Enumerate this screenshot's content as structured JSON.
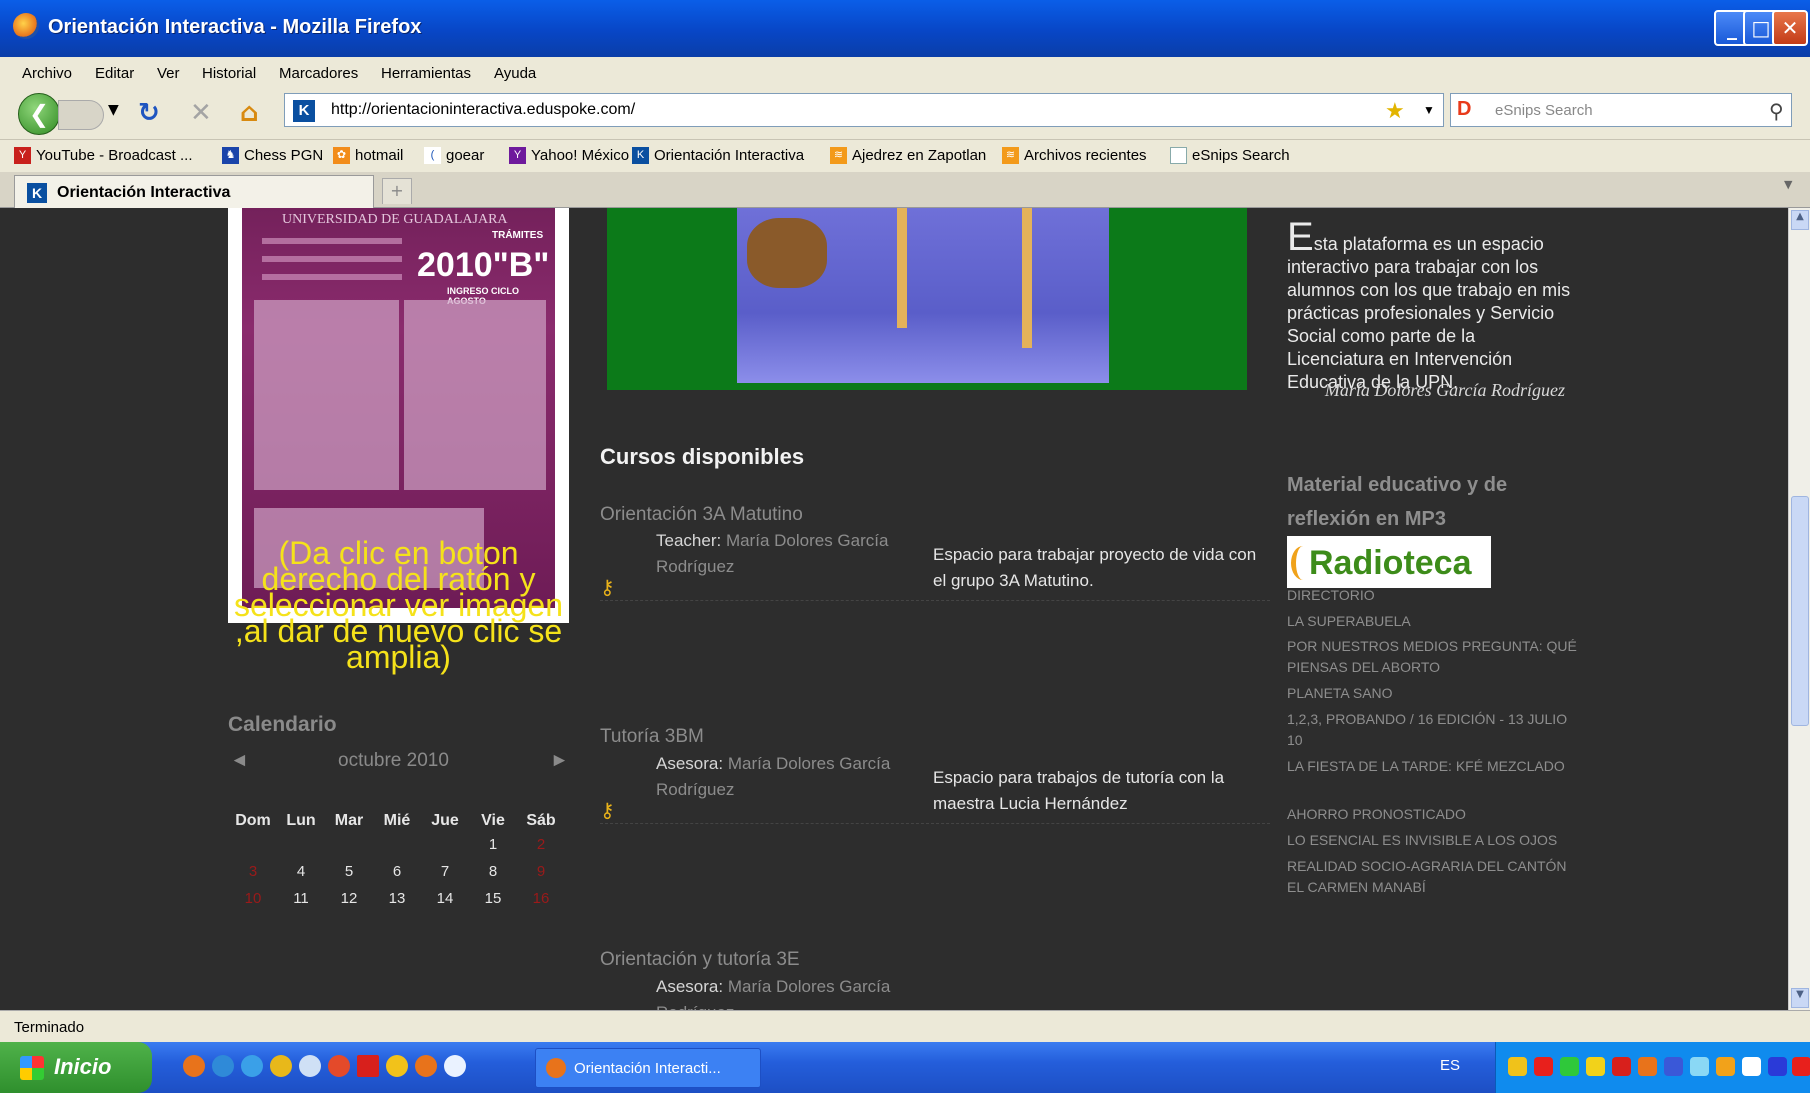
{
  "window": {
    "title": "Orientación Interactiva - Mozilla Firefox"
  },
  "menu": [
    "Archivo",
    "Editar",
    "Ver",
    "Historial",
    "Marcadores",
    "Herramientas",
    "Ayuda"
  ],
  "nav": {
    "url": "http://orientacioninteractiva.eduspoke.com/",
    "search_placeholder": "eSnips Search"
  },
  "bookmarks": [
    "YouTube - Broadcast ...",
    "Chess PGN",
    "hotmail",
    "goear",
    "Yahoo! México",
    "Orientación Interactiva",
    "Ajedrez en Zapotlan",
    "Archivos recientes",
    "eSnips Search"
  ],
  "tab": {
    "label": "Orientación Interactiva"
  },
  "poster": {
    "university": "UNIVERSIDAD DE GUADALAJARA",
    "big": "2010\"B\"",
    "sub": "INGRESO CICLO  AGOSTO",
    "tramites": "TRÁMITES"
  },
  "poster_caption": "(Da clic en boton derecho del ratón y seleccionar ver imagen ,al dar de nuevo clic se amplia)",
  "calendar": {
    "title": "Calendario",
    "month": "octubre 2010",
    "prev": "◄",
    "next": "►",
    "headers": [
      "Dom",
      "Lun",
      "Mar",
      "Mié",
      "Jue",
      "Vie",
      "Sáb"
    ],
    "row1": [
      "",
      "",
      "",
      "",
      "",
      "1",
      "2"
    ],
    "row2": [
      "3",
      "4",
      "5",
      "6",
      "7",
      "8",
      "9"
    ],
    "row3": [
      "10",
      "11",
      "12",
      "13",
      "14",
      "15",
      "16"
    ]
  },
  "courses": {
    "heading": "Cursos disponibles",
    "items": [
      {
        "title": "Orientación 3A Matutino",
        "role": "Teacher:",
        "teacher": "María Dolores García Rodríguez",
        "desc": "Espacio para trabajar proyecto de vida con el grupo 3A Matutino."
      },
      {
        "title": "Tutoría 3BM",
        "role": "Asesora:",
        "teacher": "María Dolores García Rodríguez",
        "desc": "Espacio para trabajos de tutoría con la maestra Lucia Hernández"
      },
      {
        "title": "Orientación y tutoría 3E",
        "role": "Asesora:",
        "teacher": "María Dolores García Rodríguez",
        "desc": ""
      }
    ]
  },
  "intro": {
    "dropcap": "E",
    "text": "sta plataforma es un espacio interactivo para trabajar con los alumnos con los que trabajo en mis prácticas profesionales y Servicio Social como parte de la Licenciatura en Intervención Educativa de la UPN.",
    "author": "María Dolores García Rodríguez"
  },
  "material": {
    "title": "Material educativo y de reflexión en MP3",
    "logo": "Radioteca",
    "items": [
      "DIRECTORIO",
      "LA SUPERABUELA",
      "POR NUESTROS MEDIOS PREGUNTA: QUÉ PIENSAS DEL ABORTO",
      "PLANETA SANO",
      "1,2,3, PROBANDO / 16 EDICIÓN - 13 JULIO 10",
      "LA FIESTA DE LA TARDE: KFÉ MEZCLADO",
      "AHORRO PRONOSTICADO",
      "LO ESENCIAL ES INVISIBLE A LOS OJOS",
      "REALIDAD SOCIO-AGRARIA DEL CANTÓN EL CARMEN MANABÍ"
    ]
  },
  "status": "Terminado",
  "taskbar": {
    "start": "Inicio",
    "task": "Orientación Interacti...",
    "lang": "ES"
  },
  "colors": {
    "page_bg": "#2d2d2d",
    "caption_yellow": "#f5e21a",
    "video_green": "#0c7a19",
    "titlebar_blue": "#0846c6"
  }
}
